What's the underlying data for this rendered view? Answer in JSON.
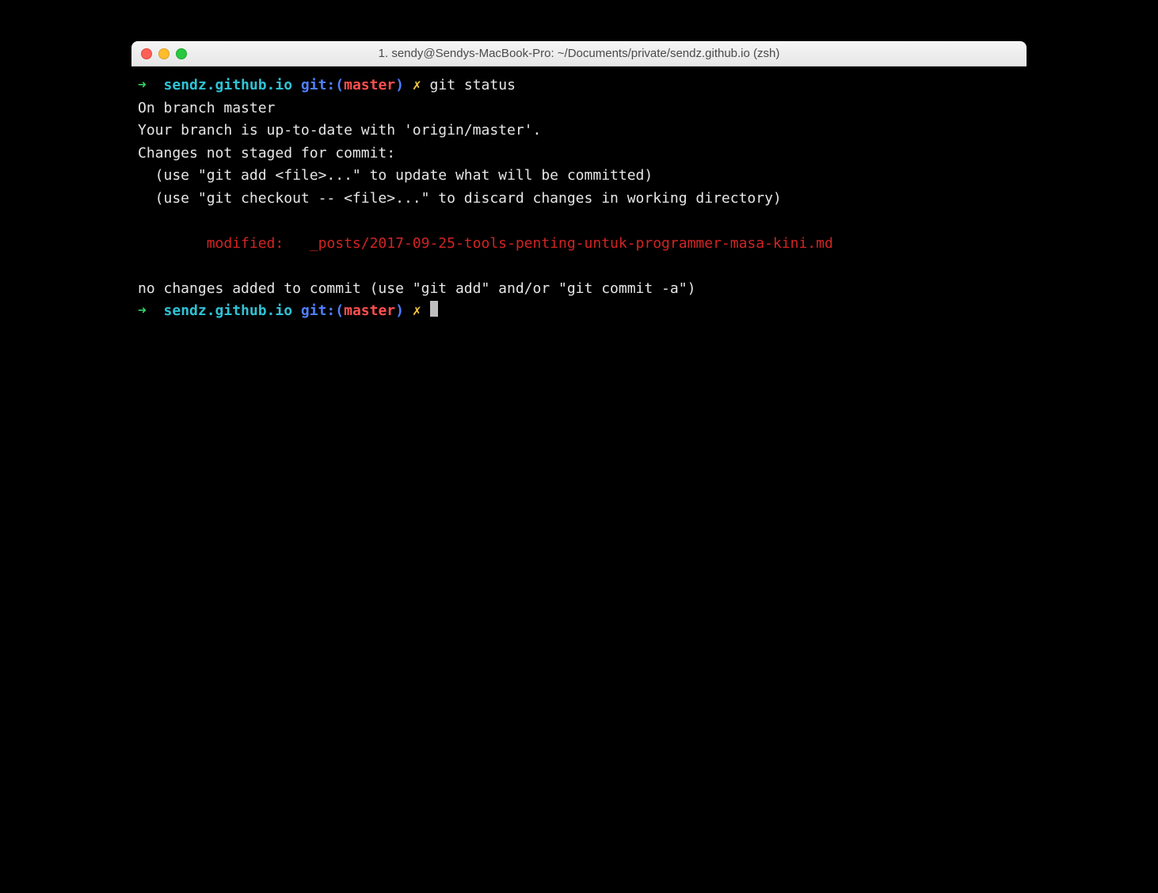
{
  "window": {
    "title": "1. sendy@Sendys-MacBook-Pro: ~/Documents/private/sendz.github.io (zsh)"
  },
  "prompt1": {
    "arrow": "➜  ",
    "cwd": "sendz.github.io",
    "git_label": "git:",
    "lparen": "(",
    "branch": "master",
    "rparen": ")",
    "dirty": "✗",
    "command": "git status"
  },
  "output": {
    "line_branch": "On branch master",
    "line_uptodate": "Your branch is up-to-date with 'origin/master'.",
    "line_changes_hdr": "Changes not staged for commit:",
    "line_hint_add": "  (use \"git add <file>...\" to update what will be committed)",
    "line_hint_checkout": "  (use \"git checkout -- <file>...\" to discard changes in working directory)",
    "line_blank1": "",
    "line_modified": "        modified:   _posts/2017-09-25-tools-penting-untuk-programmer-masa-kini.md",
    "line_blank2": "",
    "line_no_changes": "no changes added to commit (use \"git add\" and/or \"git commit -a\")"
  },
  "prompt2": {
    "arrow": "➜  ",
    "cwd": "sendz.github.io",
    "git_label": "git:",
    "lparen": "(",
    "branch": "master",
    "rparen": ")",
    "dirty": "✗"
  }
}
